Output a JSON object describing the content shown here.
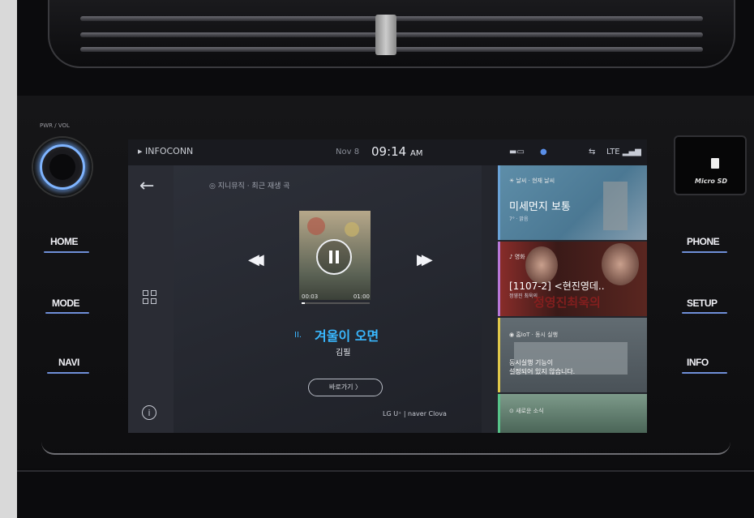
{
  "hardware": {
    "knob_label": "PWR / VOL",
    "left_buttons": [
      "HOME",
      "MODE",
      "NAVI"
    ],
    "right_buttons": [
      "PHONE",
      "SETUP",
      "INFO"
    ],
    "sd_label": "Micro SD",
    "accent_color": "#6f8fd8"
  },
  "status_bar": {
    "brand": "INFOCONN",
    "date": "Nov 8",
    "time": "09:14",
    "ampm": "AM",
    "network": "LTE"
  },
  "player": {
    "source": "지니뮤직 · 최근 재생 곡",
    "time_elapsed": "00:03",
    "time_total": "01:00",
    "progress": 0.05,
    "track_number": "II.",
    "title": "겨울이 오면",
    "artist": "김필",
    "goto_label": "바로가기 〉",
    "logos": "LG U⁺ | naver Clova",
    "title_color": "#39b8ff"
  },
  "cards": [
    {
      "header": "날씨 · 현재 날씨",
      "title": "미세먼지 보통",
      "sub": "7° · 맑음",
      "accent": "#6aa3d8"
    },
    {
      "header": "영화",
      "title": "[1107-2] <현진영데..",
      "sub": "정영진 최욱의",
      "overlay": "정영진최욱의",
      "accent": "#b878d8"
    },
    {
      "header": "홈IoT · 동시 실행",
      "title": "동시실행 기능이\n설정되어 있지 않습니다.",
      "accent": "#e0c84a"
    },
    {
      "header": "새로운 소식",
      "accent": "#58c48a"
    }
  ]
}
